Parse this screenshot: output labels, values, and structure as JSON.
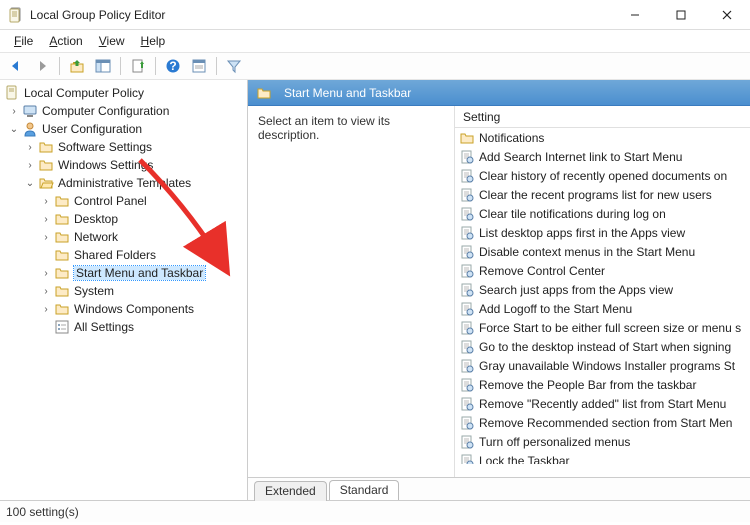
{
  "window": {
    "title": "Local Group Policy Editor"
  },
  "menu": {
    "file": "File",
    "action": "Action",
    "view": "View",
    "help": "Help"
  },
  "tree": {
    "root": "Local Computer Policy",
    "computer": "Computer Configuration",
    "user": "User Configuration",
    "software": "Software Settings",
    "windows": "Windows Settings",
    "adm": "Administrative Templates",
    "cp": "Control Panel",
    "desktop": "Desktop",
    "network": "Network",
    "shared": "Shared Folders",
    "smtb": "Start Menu and Taskbar",
    "system": "System",
    "wincomp": "Windows Components",
    "allset": "All Settings"
  },
  "content": {
    "header": "Start Menu and Taskbar",
    "desc": "Select an item to view its description.",
    "col_setting": "Setting"
  },
  "settings": [
    "Notifications",
    "Add Search Internet link to Start Menu",
    "Clear history of recently opened documents on",
    "Clear the recent programs list for new users",
    "Clear tile notifications during log on",
    "List desktop apps first in the Apps view",
    "Disable context menus in the Start Menu",
    "Remove Control Center",
    "Search just apps from the Apps view",
    "Add Logoff to the Start Menu",
    "Force Start to be either full screen size or menu s",
    "Go to the desktop instead of Start when signing",
    "Gray unavailable Windows Installer programs St",
    "Remove the People Bar from the taskbar",
    "Remove \"Recently added\" list from Start Menu",
    "Remove Recommended section from Start Men",
    "Turn off personalized menus",
    "Lock the Taskbar"
  ],
  "tabs": {
    "extended": "Extended",
    "standard": "Standard"
  },
  "status": "100 setting(s)"
}
